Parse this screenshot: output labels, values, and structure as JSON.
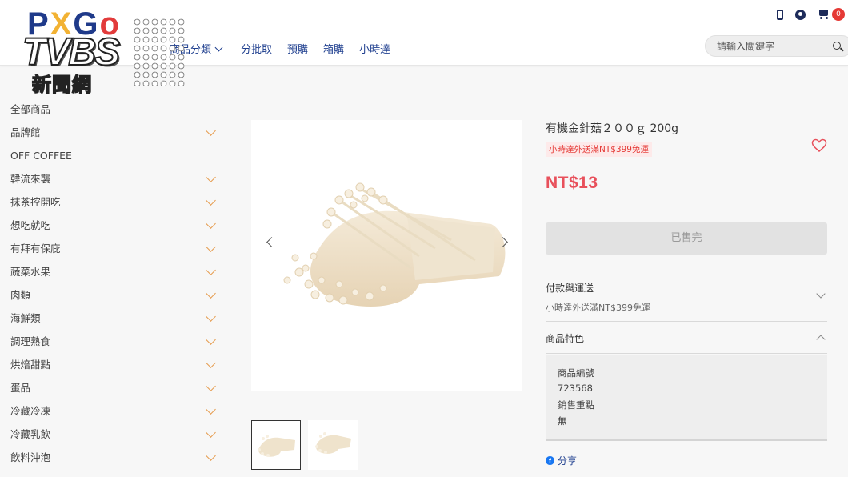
{
  "header": {
    "logo_text": "PXGo",
    "watermark": {
      "brand": "TVBS",
      "sub": "新聞網"
    },
    "nav": [
      "商品分類",
      "分批取",
      "預購",
      "箱購",
      "小時達"
    ],
    "search_placeholder": "請輸入關鍵字",
    "cart_count": "0",
    "icons": [
      "phone-icon",
      "user-icon",
      "cart-icon",
      "search-icon"
    ]
  },
  "sidebar": {
    "items": [
      {
        "label": "全部商品",
        "expandable": false
      },
      {
        "label": "品牌館",
        "expandable": true
      },
      {
        "label": "OFF COFFEE",
        "expandable": false
      },
      {
        "label": "韓流來襲",
        "expandable": true
      },
      {
        "label": "抹茶控開吃",
        "expandable": true
      },
      {
        "label": "想吃就吃",
        "expandable": true
      },
      {
        "label": "有拜有保庇",
        "expandable": true
      },
      {
        "label": "蔬菜水果",
        "expandable": true
      },
      {
        "label": "肉類",
        "expandable": true
      },
      {
        "label": "海鮮類",
        "expandable": true
      },
      {
        "label": "調理熟食",
        "expandable": true
      },
      {
        "label": "烘焙甜點",
        "expandable": true
      },
      {
        "label": "蛋品",
        "expandable": true
      },
      {
        "label": "冷藏冷凍",
        "expandable": true
      },
      {
        "label": "冷藏乳飲",
        "expandable": true
      },
      {
        "label": "飲料沖泡",
        "expandable": true
      }
    ]
  },
  "product": {
    "title": "有機金針菇２００ｇ 200g",
    "shipping_tag": "小時達外送滿NT$399免運",
    "price": "NT$13",
    "sold_out_label": "已售完",
    "payment": {
      "heading": "付款與運送",
      "sub": "小時達外送滿NT$399免運"
    },
    "features": {
      "heading": "商品特色",
      "code_label": "商品編號",
      "code_value": "723568",
      "selling_label": "銷售重點",
      "selling_value": "無"
    },
    "share_label": "分享"
  },
  "colors": {
    "brand_blue": "#1f3f8f",
    "price_red": "#e8505b",
    "accent_orange": "#e69c4f"
  }
}
